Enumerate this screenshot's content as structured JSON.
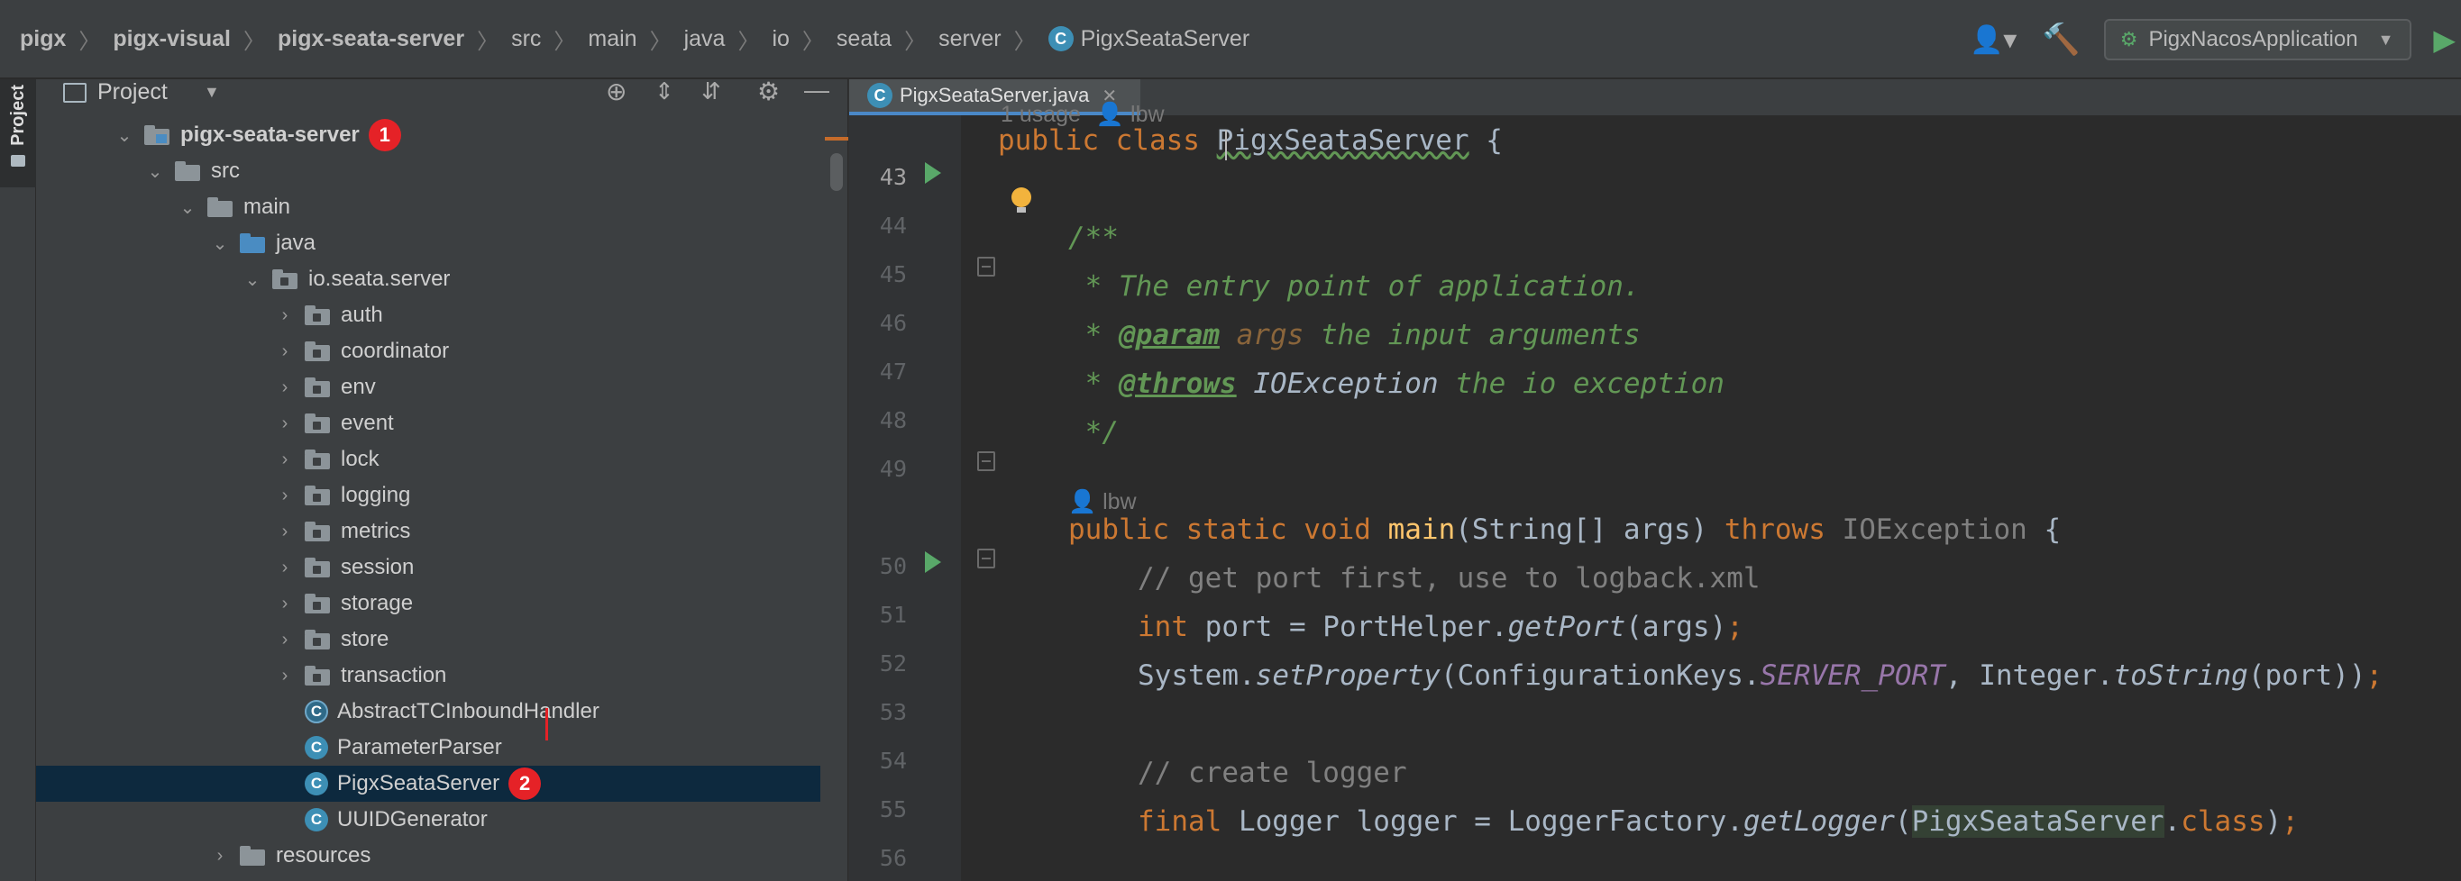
{
  "breadcrumbs": [
    "pigx",
    "pigx-visual",
    "pigx-seata-server",
    "src",
    "main",
    "java",
    "io",
    "seata",
    "server",
    "PigxSeataServer"
  ],
  "toolbar": {
    "run_config": "PigxNacosApplication"
  },
  "side_stripe": {
    "project_tab": "Project"
  },
  "project_panel": {
    "title": "Project",
    "tree": {
      "module": "pigx-seata-server",
      "src": "src",
      "main": "main",
      "java": "java",
      "package": "io.seata.server",
      "folders": [
        "auth",
        "coordinator",
        "env",
        "event",
        "lock",
        "logging",
        "metrics",
        "session",
        "storage",
        "store",
        "transaction"
      ],
      "classes": [
        "AbstractTCInboundHandler",
        "ParameterParser",
        "PigxSeataServer",
        "UUIDGenerator"
      ],
      "resources": "resources",
      "selected": "PigxSeataServer"
    },
    "badges": {
      "module_badge": "1",
      "class_badge": "2"
    }
  },
  "editor": {
    "tab_label": "PigxSeataServer.java",
    "usage_hint": "1 usage",
    "author_hint": "lbw",
    "author_hint2": "lbw",
    "line_numbers": [
      "43",
      "44",
      "45",
      "46",
      "47",
      "48",
      "49",
      "50",
      "51",
      "52",
      "53",
      "54",
      "55",
      "56"
    ],
    "code": {
      "l43_a": "public class ",
      "l43_b": "PigxSeataServer",
      "l43_c": " {",
      "l45": "/**",
      "l46": " * The entry point of application.",
      "l47_a": " * ",
      "l47_tag": "@param",
      "l47_arg": " args",
      "l47_b": " the input arguments",
      "l48_a": " * ",
      "l48_tag": "@throws",
      "l48_ex": " IOException",
      "l48_b": " the io exception",
      "l49": " */",
      "l50_a": "public static void ",
      "l50_fn": "main",
      "l50_b": "(String[] args) ",
      "l50_kw": "throws ",
      "l50_c": "IOException",
      "l50_d": " {",
      "l51": "// get port first, use to logback.xml",
      "l52_kw": "int ",
      "l52_a": "port = PortHelper.",
      "l52_fn": "getPort",
      "l52_b": "(args)",
      "l52_semi": ";",
      "l53_a": "System.",
      "l53_fn": "setProperty",
      "l53_b": "(ConfigurationKeys.",
      "l53_const": "SERVER_PORT",
      "l53_c": ", Integer.",
      "l53_fn2": "toString",
      "l53_d": "(port))",
      "l53_semi": ";",
      "l55": "// create logger",
      "l56_kw": "final ",
      "l56_a": "Logger logger = LoggerFactory.",
      "l56_fn": "getLogger",
      "l56_b": "(",
      "l56_hl": "PigxSeataServer",
      "l56_c": ".",
      "l56_kw2": "class",
      "l56_d": ")",
      "l56_semi": ";"
    }
  }
}
